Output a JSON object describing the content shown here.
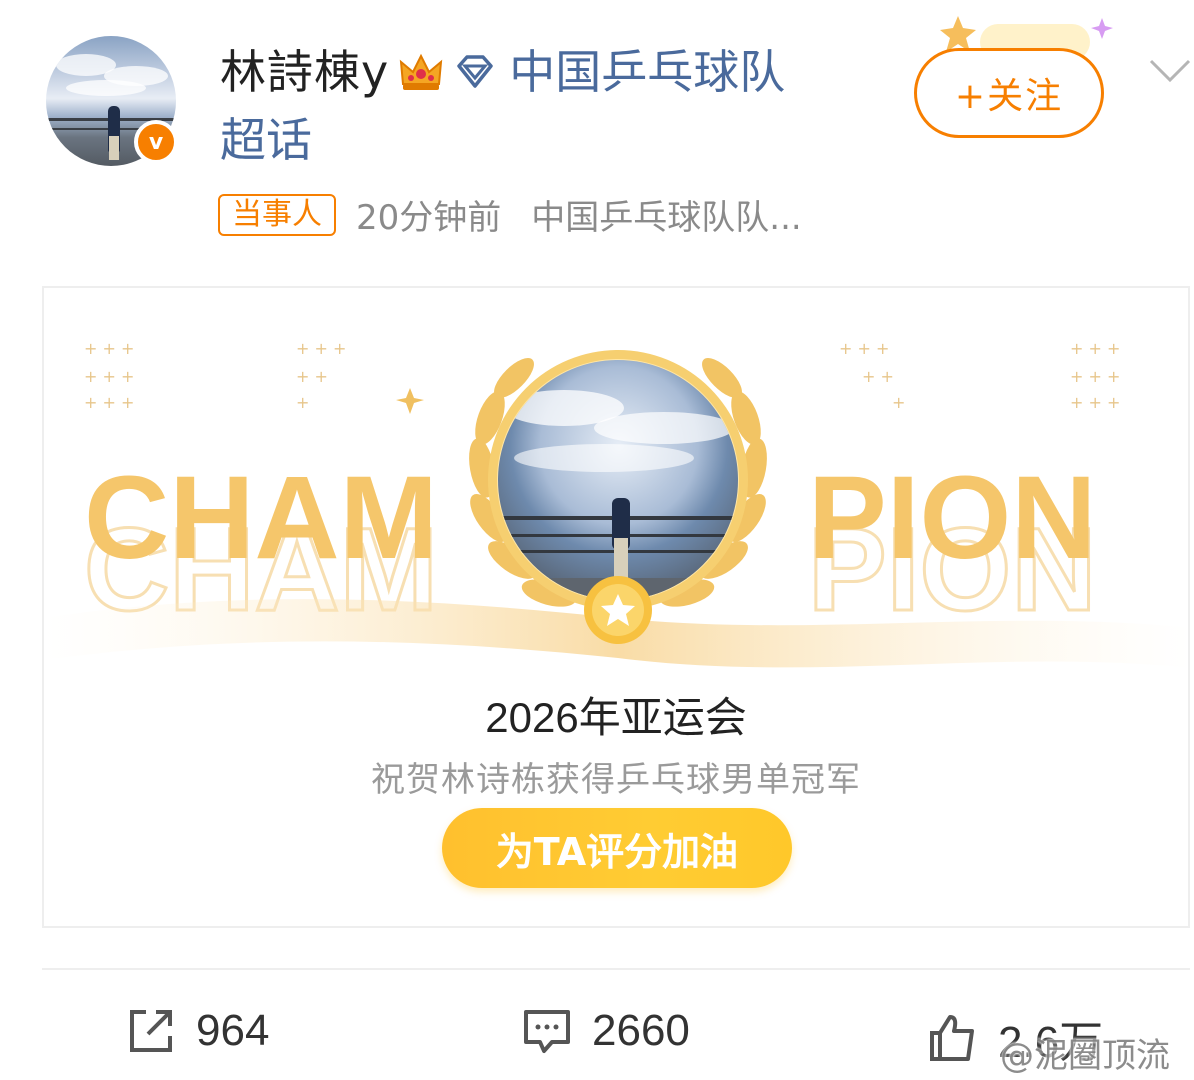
{
  "post": {
    "user_name": "林詩棟y",
    "verified_mark": "v",
    "topic": "中国乒乓球队",
    "topic_suffix": "超话",
    "follow_label": "+关注",
    "tag": "当事人",
    "time": "20分钟前",
    "source": "中国乒乓球队队..."
  },
  "card": {
    "banner_text_left": "CHAM",
    "banner_text_right": "PION",
    "title": "2026年亚运会",
    "subtitle": "祝贺林诗栋获得乒乓球男单冠军",
    "button_label": "为TA评分加油"
  },
  "actions": {
    "share_count": "964",
    "comment_count": "2660",
    "like_count": "2.6万"
  },
  "watermark": "@泥圈顶流",
  "icons": {
    "crown": "crown-icon",
    "diamond": "diamond-icon",
    "chevron": "chevron-down-icon",
    "share": "share-icon",
    "comment": "comment-icon",
    "like": "thumbs-up-icon"
  },
  "colors": {
    "accent": "#f77f00",
    "topic_link": "#4a6a9c",
    "gold": "#f5c66b",
    "button_gold": "#ffc02e"
  }
}
